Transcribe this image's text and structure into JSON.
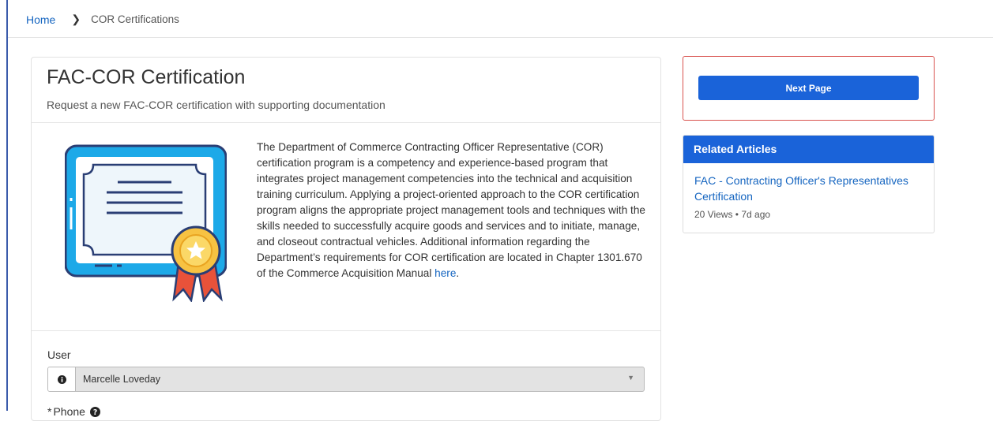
{
  "breadcrumb": {
    "home": "Home",
    "separator": "❯",
    "current": "COR Certifications"
  },
  "form": {
    "title": "FAC-COR Certification",
    "subtitle": "Request a new FAC-COR certification with supporting documentation",
    "description": "The Department of Commerce Contracting Officer Representative (COR) certification program is a competency and experience-based program that integrates project management competencies into the technical and acquisition training curriculum. Applying a project-oriented approach to the COR certification program aligns the appropriate project management tools and techniques with the skills needed to successfully acquire goods and services and to initiate, manage, and closeout contractual vehicles. Additional information regarding the Department’s requirements for COR certification are located in Chapter 1301.670 of the Commerce Acquisition Manual ",
    "description_link": "here",
    "description_end": ".",
    "user_label": "User",
    "user_value": "Marcelle Loveday",
    "phone_required_mark": "*",
    "phone_label": "Phone"
  },
  "sidebar": {
    "next_button": "Next Page",
    "related_title": "Related Articles",
    "article_title": "FAC - Contracting Officer's Representatives Certification",
    "article_meta": "20 Views • 7d ago"
  },
  "colors": {
    "primary": "#1a63d9",
    "link": "#1565c0",
    "alert_border": "#d9534f"
  },
  "icons": [
    "chevron-right-icon",
    "certificate-icon",
    "info-icon",
    "caret-down-icon",
    "help-icon"
  ]
}
